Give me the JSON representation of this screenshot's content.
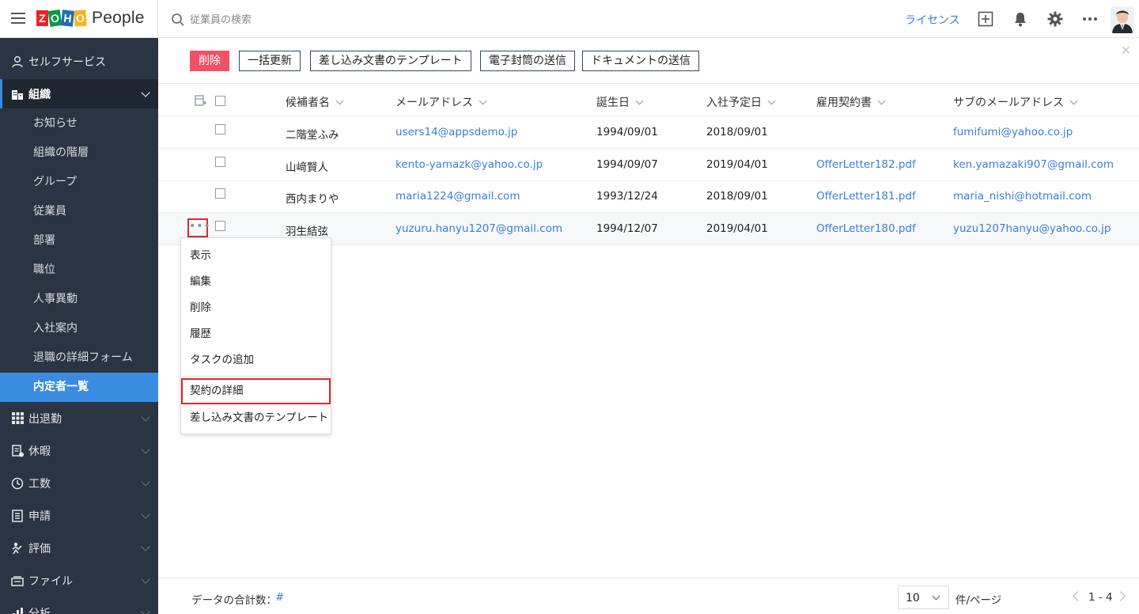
{
  "brand": {
    "logo_letters": [
      "Z",
      "O",
      "H",
      "O"
    ],
    "logo_colors": [
      "#e42527",
      "#089949",
      "#226db4",
      "#f9b21d"
    ],
    "product": "People"
  },
  "search": {
    "placeholder": "従業員の検索"
  },
  "topbar": {
    "license": "ライセンス",
    "icons": [
      "add-icon",
      "bell-icon",
      "gear-icon",
      "more-icon",
      "avatar"
    ]
  },
  "sidebar": {
    "self_service": "セルフサービス",
    "org": "組織",
    "org_items": [
      "お知らせ",
      "組織の階層",
      "グループ",
      "従業員",
      "部署",
      "職位",
      "人事異動",
      "入社案内",
      "退職の詳細フォーム",
      "内定者一覧"
    ],
    "active_item": "内定者一覧",
    "sections": [
      "出退勤",
      "休暇",
      "工数",
      "申請",
      "評価",
      "ファイル",
      "分析"
    ]
  },
  "actions": {
    "delete": "削除",
    "bulk_update": "一括更新",
    "mail_merge_template": "差し込み文書のテンプレート",
    "send_envelope": "電子封筒の送信",
    "send_document": "ドキュメントの送信",
    "close": "✕"
  },
  "table": {
    "headers": [
      "候補者名",
      "メールアドレス",
      "誕生日",
      "入社予定日",
      "雇用契約書",
      "サブのメールアドレス"
    ],
    "rows": [
      {
        "name": "二階堂ふみ",
        "email": "users14@appsdemo.jp",
        "birthday": "1994/09/01",
        "join_date": "2018/09/01",
        "contract": "",
        "sub_email": "fumifumi@yahoo.co.jp"
      },
      {
        "name": "山﨑賢人",
        "email": "kento-yamazk@yahoo.co.jp",
        "birthday": "1994/09/07",
        "join_date": "2019/04/01",
        "contract": "OfferLetter182.pdf",
        "sub_email": "ken.yamazaki907@gmail.com"
      },
      {
        "name": "西内まりや",
        "email": "maria1224@gmail.com",
        "birthday": "1993/12/24",
        "join_date": "2018/09/01",
        "contract": "OfferLetter181.pdf",
        "sub_email": "maria_nishi@hotmail.com"
      },
      {
        "name": "羽生結弦",
        "email": "yuzuru.hanyu1207@gmail.com",
        "birthday": "1994/12/07",
        "join_date": "2019/04/01",
        "contract": "OfferLetter180.pdf",
        "sub_email": "yuzu1207hanyu@yahoo.co.jp"
      }
    ]
  },
  "row_menu": {
    "more": "•••",
    "items": [
      "表示",
      "編集",
      "削除",
      "履歴",
      "タスクの追加"
    ],
    "contract_details": "契約の詳細",
    "mail_merge_template": "差し込み文書のテンプレート"
  },
  "footer": {
    "total_label": "データの合計数：",
    "total_value": "#",
    "page_size": "10",
    "per_page": "件/ページ",
    "range": "1 - 4"
  },
  "colors": {
    "sidebar_bg": "#2b3442",
    "active_blue": "#3a8ce3",
    "link_blue": "#3b7dd8",
    "danger": "#f05166",
    "highlight_red": "#e0262d"
  }
}
